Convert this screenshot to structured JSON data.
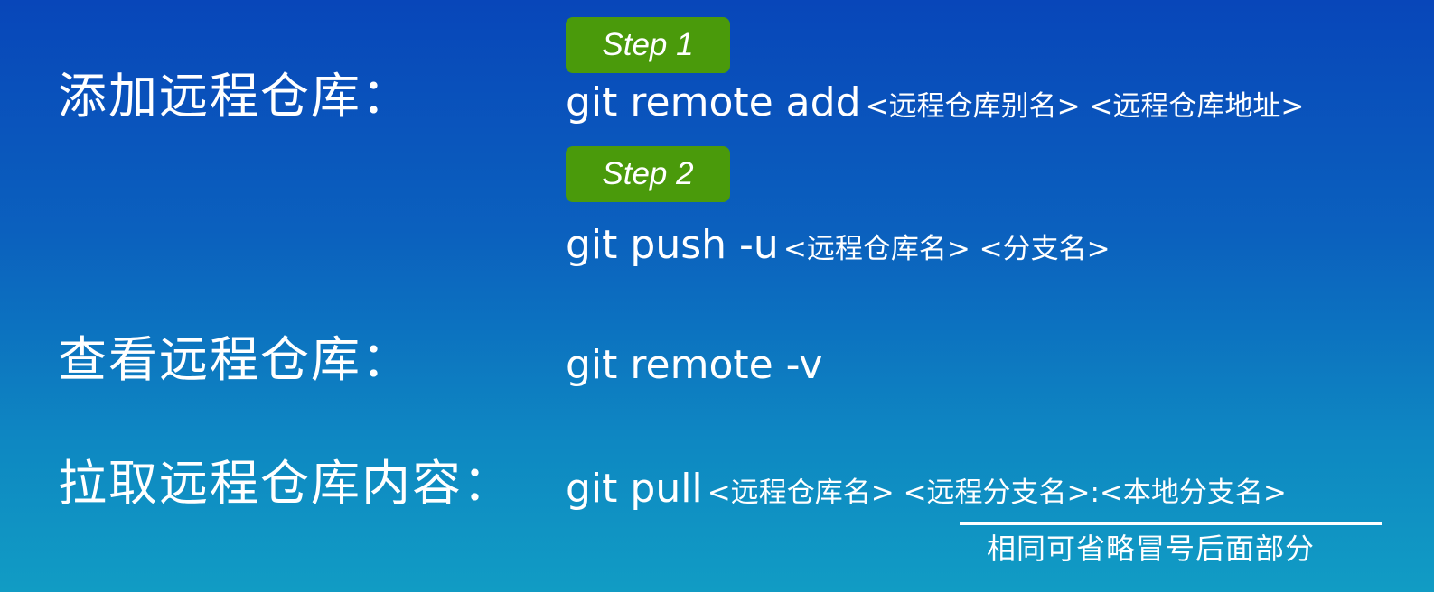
{
  "rows": [
    {
      "label": "添加远程仓库：",
      "step_badge": "Step 1",
      "command": "git remote add",
      "args": "<远程仓库别名> <远程仓库地址>"
    },
    {
      "step_badge": "Step 2",
      "command": "git push -u",
      "args": "<远程仓库名> <分支名>"
    },
    {
      "label": "查看远程仓库：",
      "command": "git remote -v"
    },
    {
      "label": "拉取远程仓库内容：",
      "command": "git pull",
      "args": "<远程仓库名> <远程分支名>:<本地分支名>"
    }
  ],
  "note": "相同可省略冒号后面部分",
  "colors": {
    "badge": "#4a9a0b",
    "text": "#ffffff",
    "background_top": "#0846b9",
    "background_bottom": "#119cc4"
  }
}
